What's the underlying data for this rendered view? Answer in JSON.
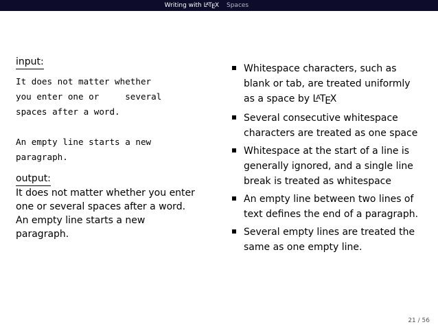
{
  "header": {
    "current_section": {
      "prefix": "Writing with",
      "logo_text": "LaTeX"
    },
    "next_section": "Spaces"
  },
  "left_column": {
    "input_label": "input:",
    "input_code": "It does not matter whether\nyou enter one or     several\nspaces after a word.\n\nAn empty line starts a new\nparagraph.",
    "output_label": "output:",
    "output_lines": [
      "It does not matter whether you enter",
      "one or several spaces after a word.",
      "An empty line starts a new",
      "paragraph."
    ]
  },
  "bullets": [
    {
      "lines": [
        "Whitespace characters, such as",
        "blank or tab, are treated uniformly",
        "as a space by"
      ],
      "trailing_logo": "LaTeX"
    },
    {
      "lines": [
        "Several consecutive whitespace",
        "characters are treated as one space"
      ]
    },
    {
      "lines": [
        "Whitespace at the start of a line is",
        "generally ignored, and a single line",
        "break is treated as whitespace"
      ]
    },
    {
      "lines": [
        "An empty line between two lines of",
        "text defines the end of a paragraph."
      ]
    },
    {
      "lines": [
        "Several empty lines are treated the",
        "same as one empty line."
      ]
    }
  ],
  "footer": {
    "page_number": "21 / 56"
  }
}
